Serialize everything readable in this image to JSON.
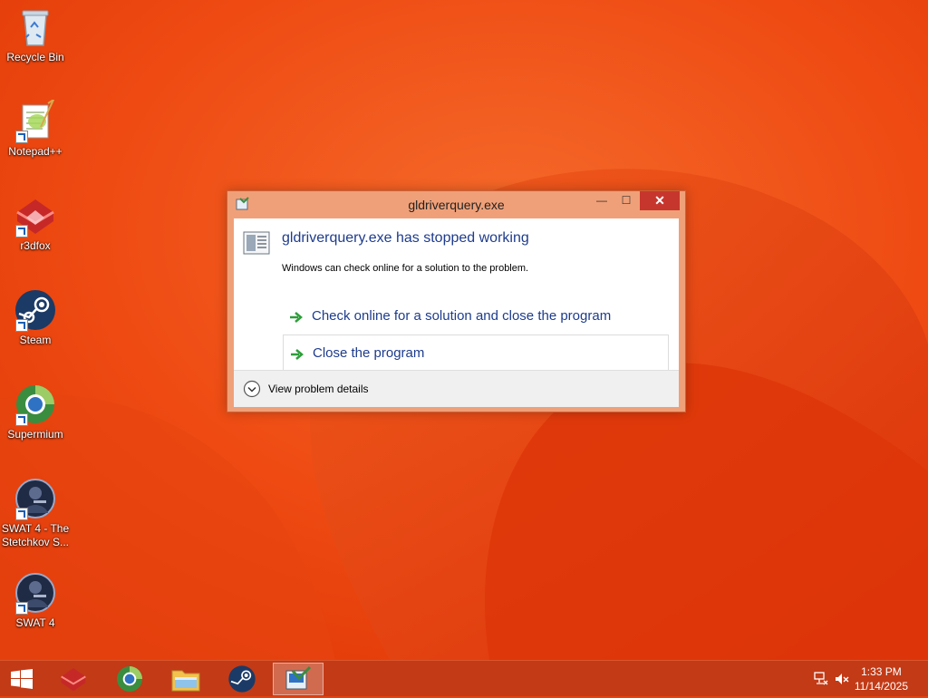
{
  "desktop": {
    "icons": [
      {
        "label": "Recycle Bin",
        "icon": "recycle-bin-icon"
      },
      {
        "label": "Notepad++",
        "icon": "notepad-plus-plus-icon"
      },
      {
        "label": "r3dfox",
        "icon": "r3dfox-icon"
      },
      {
        "label": "Steam",
        "icon": "steam-icon"
      },
      {
        "label": "Supermium",
        "icon": "supermium-icon"
      },
      {
        "label": "SWAT 4 - The Stetchkov S...",
        "icon": "swat4-tss-icon"
      },
      {
        "label": "SWAT 4",
        "icon": "swat4-icon"
      }
    ]
  },
  "dialog": {
    "title": "gldriverquery.exe",
    "heading": "gldriverquery.exe has stopped working",
    "subtext": "Windows can check online for a solution to the problem.",
    "options": [
      {
        "label": "Check online for a solution and close the program"
      },
      {
        "label": "Close the program"
      }
    ],
    "details_label": "View problem details",
    "controls": {
      "minimize": "—",
      "maximize": "☐",
      "close": "✕"
    }
  },
  "taskbar": {
    "apps": [
      "r3dfox-icon",
      "supermium-icon",
      "file-explorer-icon",
      "steam-icon",
      "problem-reporting-icon"
    ],
    "tray": {
      "time": "1:33 PM",
      "date": "11/14/2025"
    }
  },
  "colors": {
    "accent": "#c7362d",
    "link": "#1e3c8c",
    "taskbar": "#c23a16"
  }
}
